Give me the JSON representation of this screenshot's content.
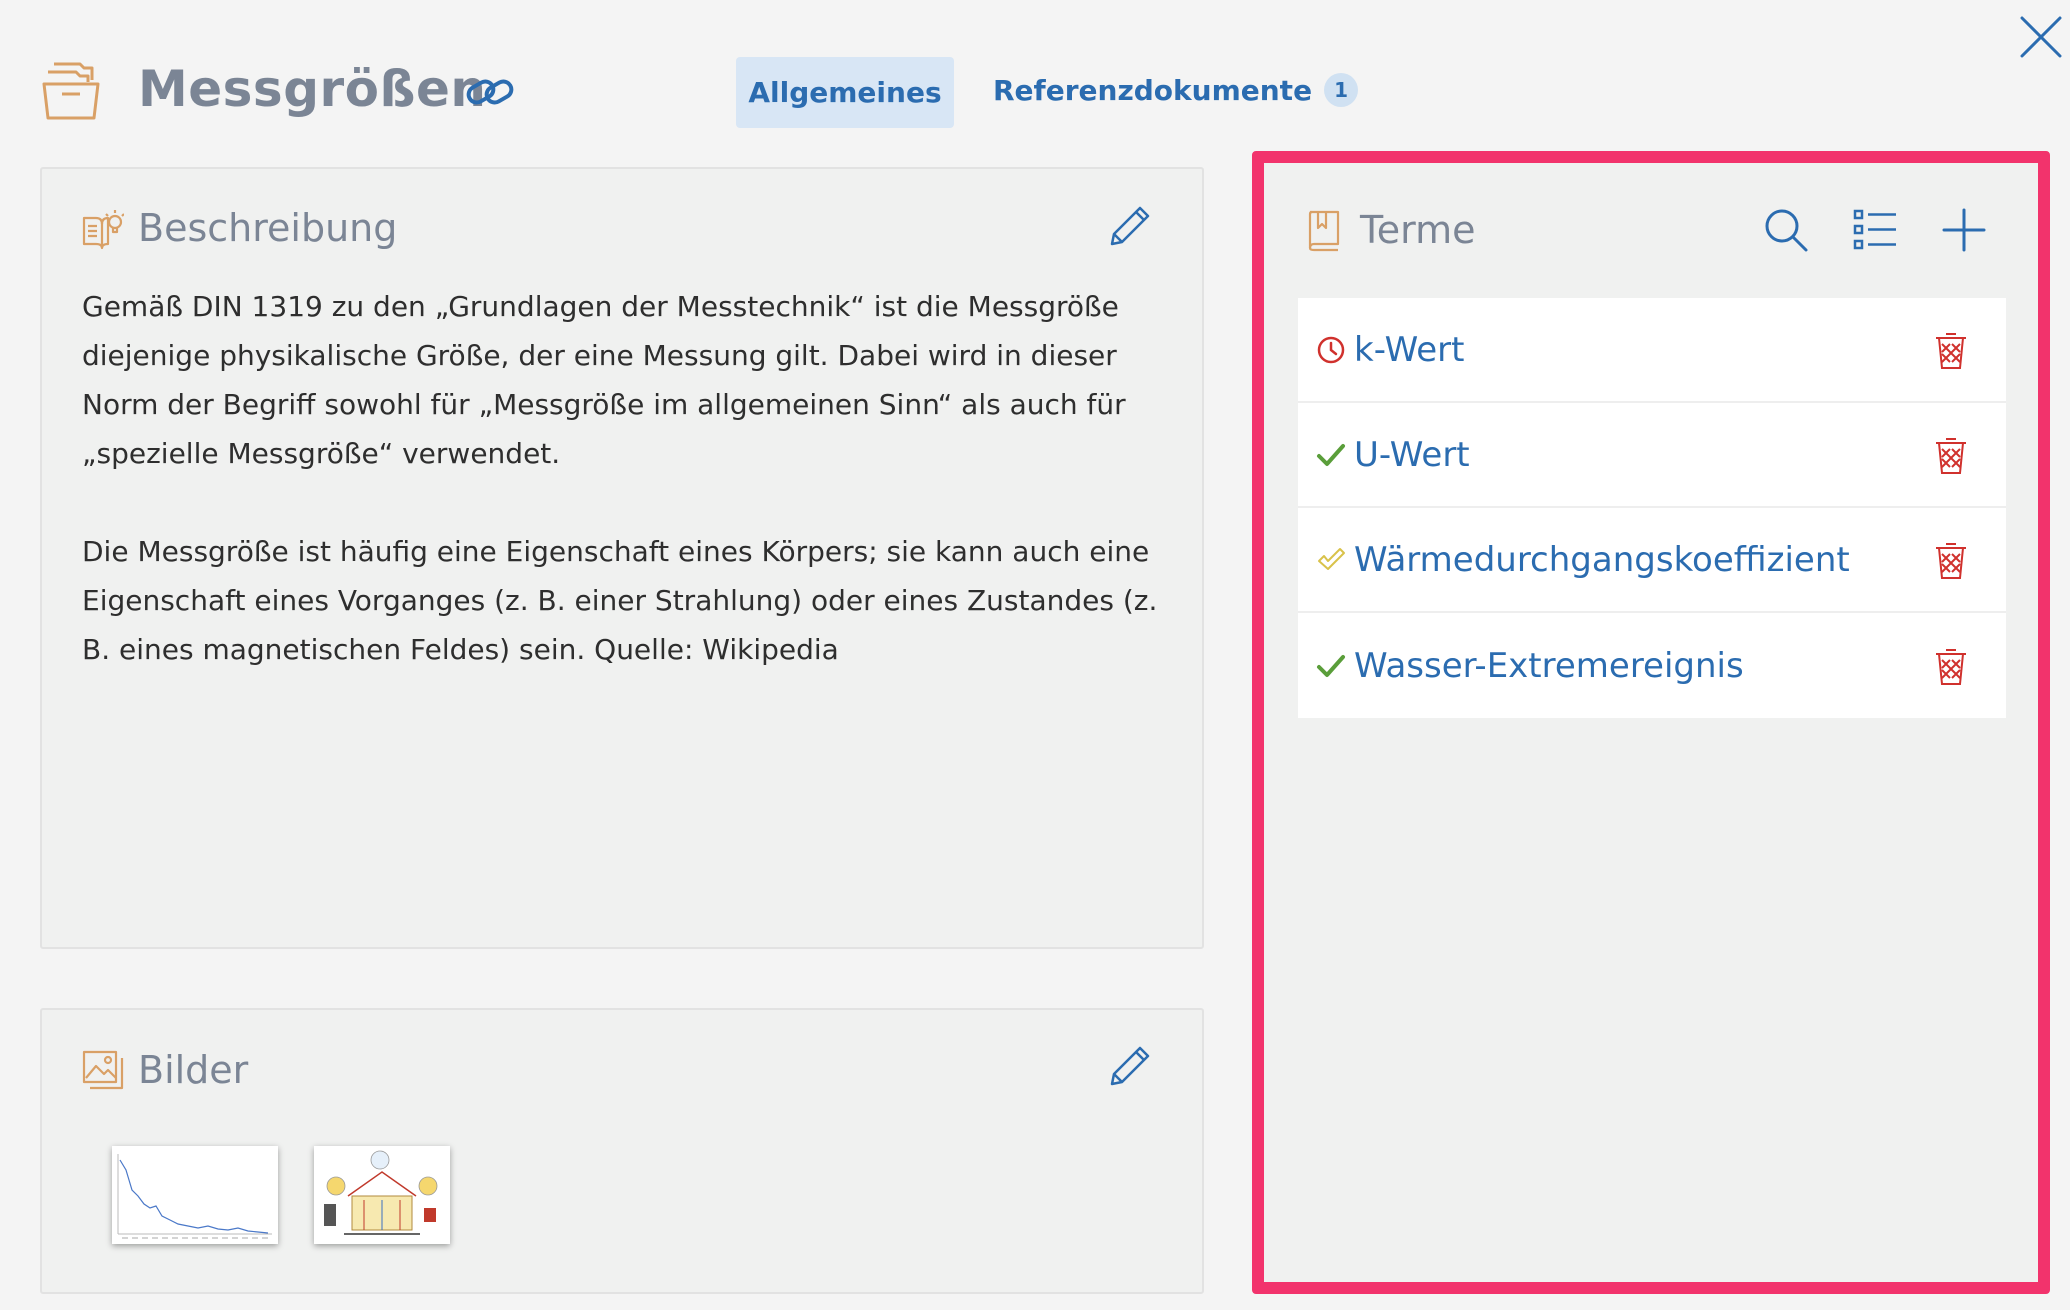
{
  "header": {
    "title": "Messgrößen",
    "tabs": [
      {
        "label": "Allgemeines",
        "active": true
      },
      {
        "label": "Referenzdokumente",
        "badge": "1",
        "active": false
      }
    ]
  },
  "description": {
    "title": "Beschreibung",
    "paragraphs": [
      "Gemäß DIN 1319 zu den „Grundlagen der Messtechnik“ ist die Messgröße diejenige physikalische Größe, der eine Messung gilt. Dabei wird in dieser Norm der Begriff sowohl für „Messgröße im allgemeinen Sinn“ als auch für „spezielle Messgröße“ verwendet.",
      "Die Messgröße ist häufig eine Eigenschaft eines Körpers; sie kann auch eine Eigenschaft eines Vorganges (z. B. einer Strahlung) oder eines Zustandes (z. B. eines magnetischen Feldes) sein. Quelle: Wikipedia"
    ]
  },
  "images": {
    "title": "Bilder"
  },
  "terms": {
    "title": "Terme",
    "items": [
      {
        "label": "k-Wert",
        "status": "pending",
        "status_color": "#d0312d"
      },
      {
        "label": "U-Wert",
        "status": "approved",
        "status_color": "#5a9e3a"
      },
      {
        "label": "Wärmedurchgangskoeffizient",
        "status": "partially-approved",
        "status_color": "#d9c24a"
      },
      {
        "label": "Wasser-Extremereignis",
        "status": "approved",
        "status_color": "#5a9e3a"
      }
    ]
  },
  "colors": {
    "accent": "#2b6cb0",
    "highlight_border": "#f2336c",
    "icon_orange": "#d9a066",
    "delete_red": "#d0312d"
  }
}
